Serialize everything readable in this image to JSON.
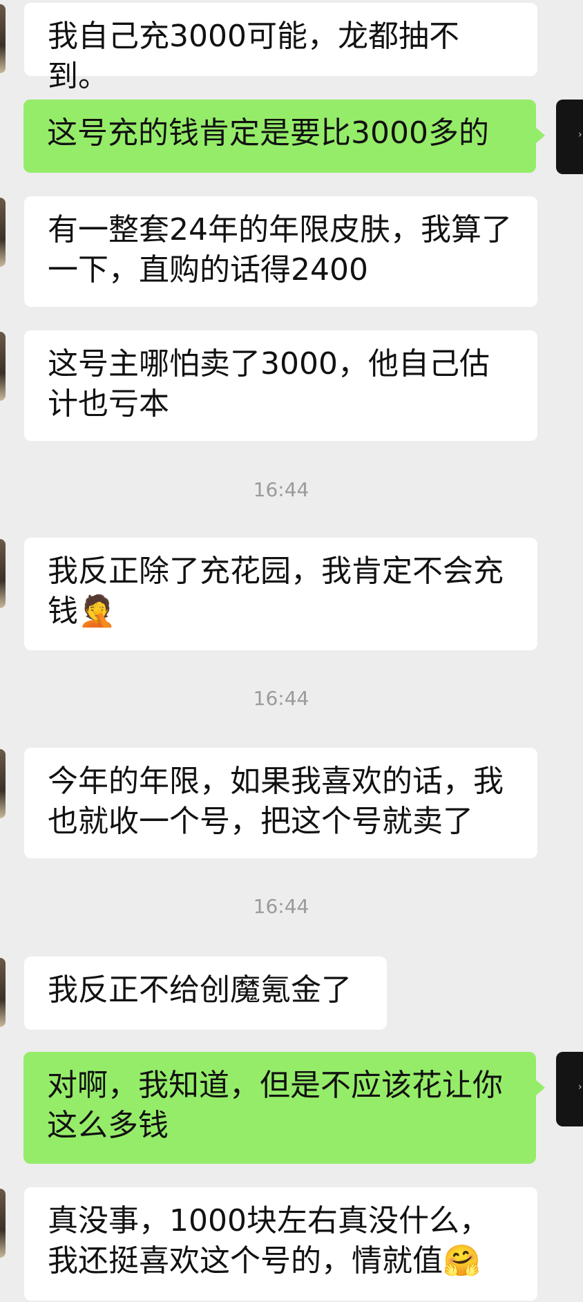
{
  "messages": [
    {
      "side": "in",
      "text": "我自己充3000可能，龙都抽不到。"
    },
    {
      "side": "out",
      "text": "这号充的钱肯定是要比3000多的"
    },
    {
      "side": "in",
      "text": "有一整套24年的年限皮肤，我算了一下，直购的话得2400"
    },
    {
      "side": "in",
      "text": "这号主哪怕卖了3000，他自己估计也亏本"
    },
    {
      "time": "16:44"
    },
    {
      "side": "in",
      "text": "我反正除了充花园，我肯定不会充钱",
      "emoji": "🤦"
    },
    {
      "time": "16:44"
    },
    {
      "side": "in",
      "text": "今年的年限，如果我喜欢的话，我也就收一个号，把这个号就卖了"
    },
    {
      "time": "16:44"
    },
    {
      "side": "in",
      "text": "我反正不给创魔氪金了"
    },
    {
      "side": "out",
      "text": "对啊，我知道，但是不应该花让你这么多钱"
    },
    {
      "side": "in",
      "text": "真没事，1000块左右真没什么，我还挺喜欢这个号的，情就值",
      "emoji": "🤗"
    }
  ],
  "colors": {
    "background": "#ededed",
    "incoming_bubble": "#ffffff",
    "outgoing_bubble": "#95ec69",
    "timestamp_text": "#9a9a9a",
    "message_text": "#111111"
  },
  "icons": {
    "left_avatar": "contact-avatar-icon",
    "right_avatar": "self-avatar-icon"
  }
}
